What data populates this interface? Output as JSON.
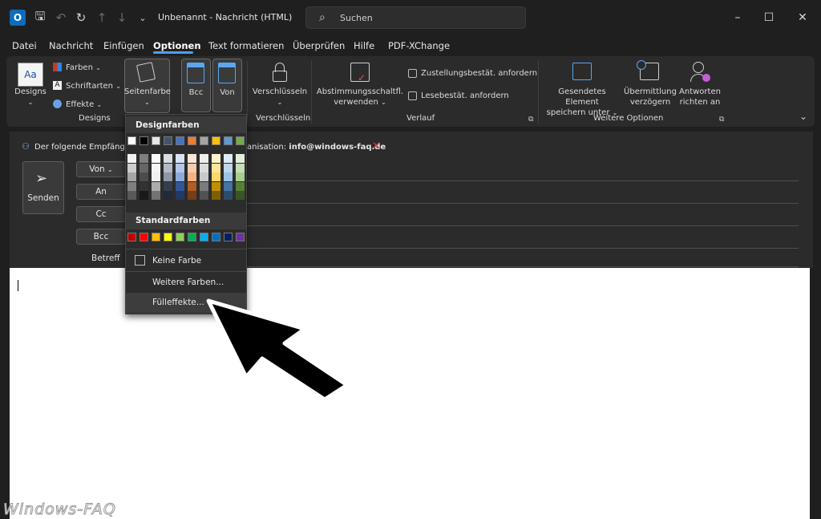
{
  "window": {
    "title": "Unbenannt  -  Nachricht (HTML)",
    "search_placeholder": "Suchen",
    "minimize": "–",
    "maximize": "☐",
    "close": "✕"
  },
  "quick_access": {
    "logo": "O",
    "save": "🖫",
    "undo": "↶",
    "redo": "↻",
    "up": "↑",
    "down": "↓",
    "customize": "⌄"
  },
  "menu": [
    "Datei",
    "Nachricht",
    "Einfügen",
    "Optionen",
    "Text formatieren",
    "Überprüfen",
    "Hilfe",
    "PDF-XChange"
  ],
  "active_menu": "Optionen",
  "ribbon": {
    "designs": {
      "label": "Designs",
      "icon_text": "Aa",
      "colors": "Farben",
      "fonts": "Schriftarten",
      "effects": "Effekte",
      "group": "Designs"
    },
    "seitenfarbe": "Seitenfarbe",
    "bcc": "Bcc",
    "von": "Von",
    "verschluesseln": {
      "label": "Verschlüsseln",
      "group": "Verschlüsseln"
    },
    "verlauf": {
      "voting_line1": "Abstimmungsschaltfl.",
      "voting_line2": "verwenden",
      "delivery": "Zustellungsbestät. anfordern",
      "read": "Lesebestät. anfordern",
      "group": "Verlauf"
    },
    "weitere": {
      "save_line1": "Gesendetes Element",
      "save_line2": "speichern unter",
      "delay_line1": "Übermittlung",
      "delay_line2": "verzögern",
      "reply_line1": "Antworten",
      "reply_line2": "richten an",
      "group": "Weitere Optionen"
    }
  },
  "compose": {
    "info_start": "Der folgende Empfänger",
    "info_end": "anisation: ",
    "info_email": "info@windows-faq.de",
    "send": "Senden",
    "von": "Von",
    "an": "An",
    "cc": "Cc",
    "bcc": "Bcc",
    "betreff": "Betreff"
  },
  "dropdown": {
    "design_header": "Designfarben",
    "standard_header": "Standardfarben",
    "no_color": "Keine Farbe",
    "more_colors": "Weitere Farben...",
    "fill_effects": "Fülleffekte..."
  },
  "colors": {
    "theme": [
      "#ffffff",
      "#000000",
      "#e7e6e6",
      "#44546a",
      "#4472c4",
      "#ed7d31",
      "#a5a5a5",
      "#ffc000",
      "#5b9bd5",
      "#70ad47"
    ],
    "standard": [
      "#c00000",
      "#ff0000",
      "#ffc000",
      "#ffff00",
      "#92d050",
      "#00b050",
      "#00b0f0",
      "#0070c0",
      "#002060",
      "#7030a0"
    ],
    "accent": "#4aa0f0"
  },
  "watermark": "Windows-FAQ"
}
